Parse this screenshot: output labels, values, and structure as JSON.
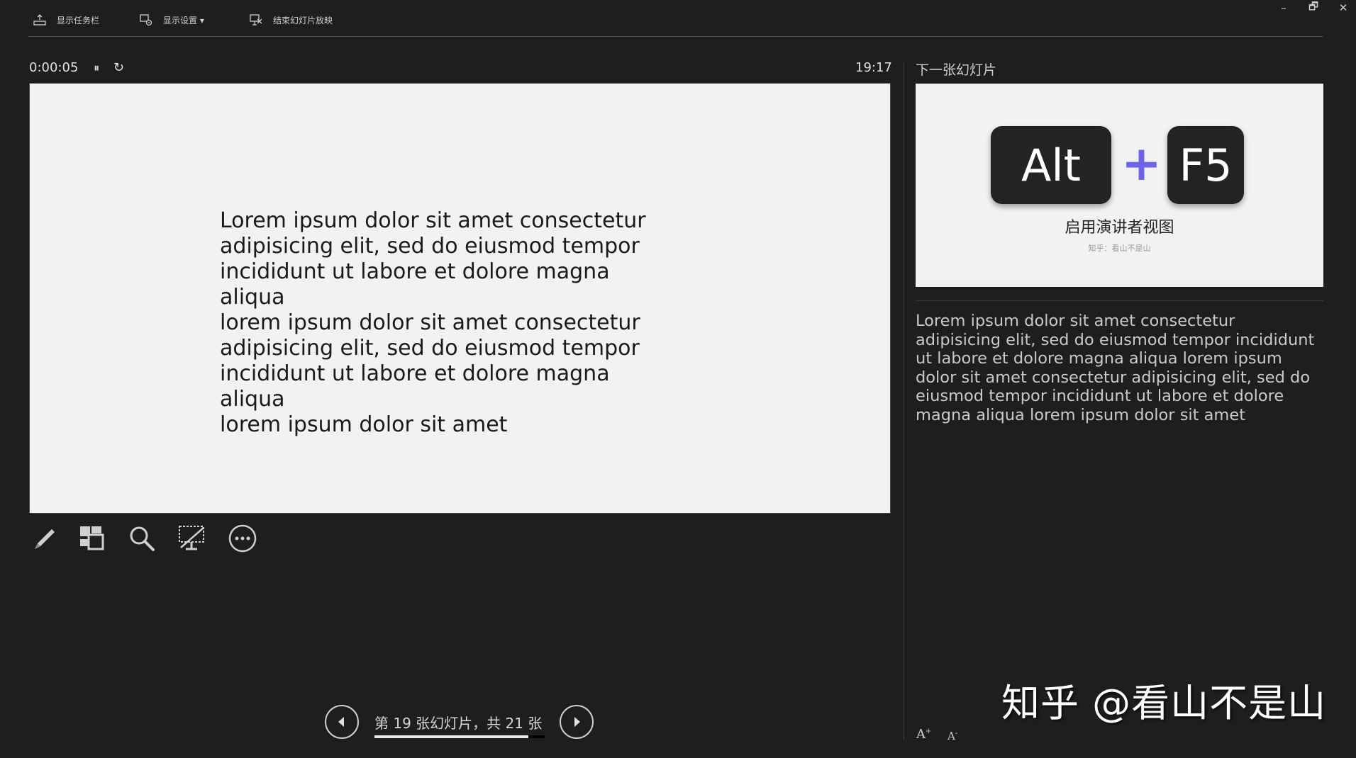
{
  "toolbar": {
    "show_taskbar": "显示任务栏",
    "display_settings": "显示设置 ▾",
    "end_show": "结束幻灯片放映"
  },
  "window_controls": {
    "minimize": "–",
    "restore": "🗗",
    "close": "✕"
  },
  "timer": {
    "elapsed": "0:00:05",
    "pause_glyph": "⏸",
    "restart_glyph": "↻",
    "clock": "19:17"
  },
  "current_slide": {
    "lines": [
      "Lorem ipsum dolor sit amet consectetur",
      "adipisicing elit, sed do eiusmod tempor",
      "incididunt ut labore et dolore magna aliqua",
      "lorem ipsum dolor sit amet consectetur",
      "adipisicing elit, sed do eiusmod tempor",
      "incididunt ut labore et dolore magna aliqua",
      "lorem ipsum dolor sit amet"
    ]
  },
  "next_slide": {
    "label": "下一张幻灯片",
    "key1": "Alt",
    "plus": "+",
    "key2": "F5",
    "title": "启用演讲者视图",
    "subtitle": "知乎：看山不是山",
    "plus_color": "#6c63e8"
  },
  "notes": {
    "text": "Lorem ipsum dolor sit amet consectetur adipisicing elit, sed do eiusmod tempor incididunt ut labore et dolore magna aliqua lorem ipsum dolor sit amet consectetur adipisicing elit, sed do eiusmod tempor incididunt ut labore et dolore magna aliqua lorem ipsum dolor sit amet"
  },
  "tools": [
    "pen-icon",
    "all-slides-icon",
    "zoom-icon",
    "black-screen-icon",
    "more-options-icon"
  ],
  "navigation": {
    "label": "第 19 张幻灯片，共 21 张",
    "current": 19,
    "total": 21,
    "progress_fraction": 0.905
  },
  "font_size": {
    "increase": "A",
    "decrease": "A"
  },
  "watermark": "知乎 @看山不是山"
}
